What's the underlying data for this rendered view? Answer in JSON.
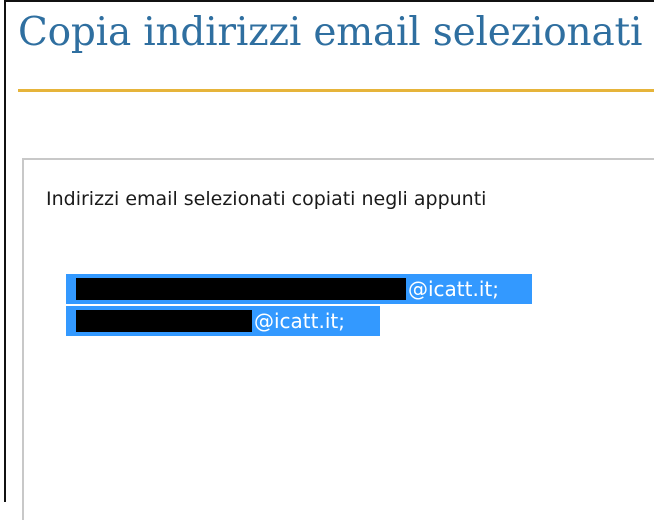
{
  "page": {
    "title": "Copia indirizzi email selezionati"
  },
  "dialog": {
    "message": "Indirizzi email selezionati copiati negli appunti"
  },
  "selected_emails": [
    {
      "domain_text": "@icatt.it;"
    },
    {
      "domain_text": "@icatt.it;"
    }
  ],
  "colors": {
    "title": "#2f6fa0",
    "title_rule": "#e6b43a",
    "selection": "#3399ff",
    "redaction": "#000000"
  },
  "icons": []
}
